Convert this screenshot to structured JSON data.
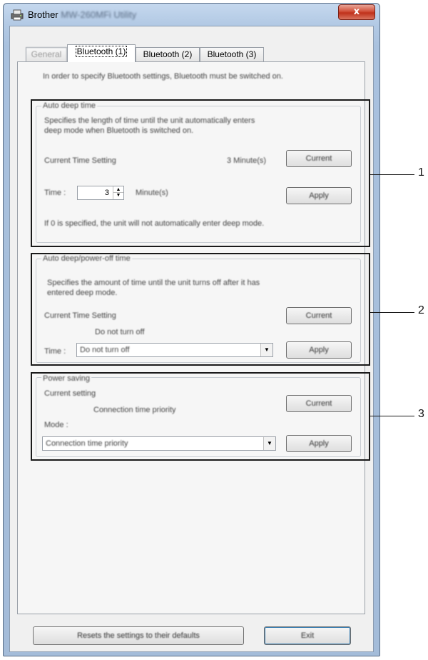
{
  "window": {
    "title_app": "Brother",
    "title_model": "MW-260MFi Utility",
    "close_glyph": "x"
  },
  "tabs": [
    {
      "label": "General"
    },
    {
      "label": "Bluetooth (1)"
    },
    {
      "label": "Bluetooth (2)"
    },
    {
      "label": "Bluetooth (3)"
    }
  ],
  "intro_text": "In order to specify Bluetooth settings, Bluetooth must be switched on.",
  "auto_deep": {
    "legend": "Auto deep time",
    "description_1": "Specifies the length of time until the unit automatically enters",
    "description_2": "deep mode when Bluetooth is switched on.",
    "current_label": "Current Time Setting",
    "current_value": "3 Minute(s)",
    "current_button": "Current",
    "time_label": "Time :",
    "time_value": "3",
    "time_unit": "Minute(s)",
    "apply_button": "Apply",
    "note": "If 0 is specified, the unit will not automatically enter deep mode."
  },
  "auto_off": {
    "legend": "Auto deep/power-off time",
    "description_1": "Specifies the amount of time until the unit turns off after it has",
    "description_2": "entered deep mode.",
    "current_label": "Current Time Setting",
    "current_value": "Do not turn off",
    "current_button": "Current",
    "time_label": "Time :",
    "time_value": "Do not turn off",
    "apply_button": "Apply"
  },
  "power_saving": {
    "legend": "Power saving",
    "current_label": "Current setting",
    "current_value": "Connection time priority",
    "current_button": "Current",
    "mode_label": "Mode :",
    "mode_value": "Connection time priority",
    "apply_button": "Apply"
  },
  "footer": {
    "reset_button": "Resets the settings to their defaults",
    "exit_button": "Exit"
  },
  "callouts": [
    "1",
    "2",
    "3"
  ]
}
